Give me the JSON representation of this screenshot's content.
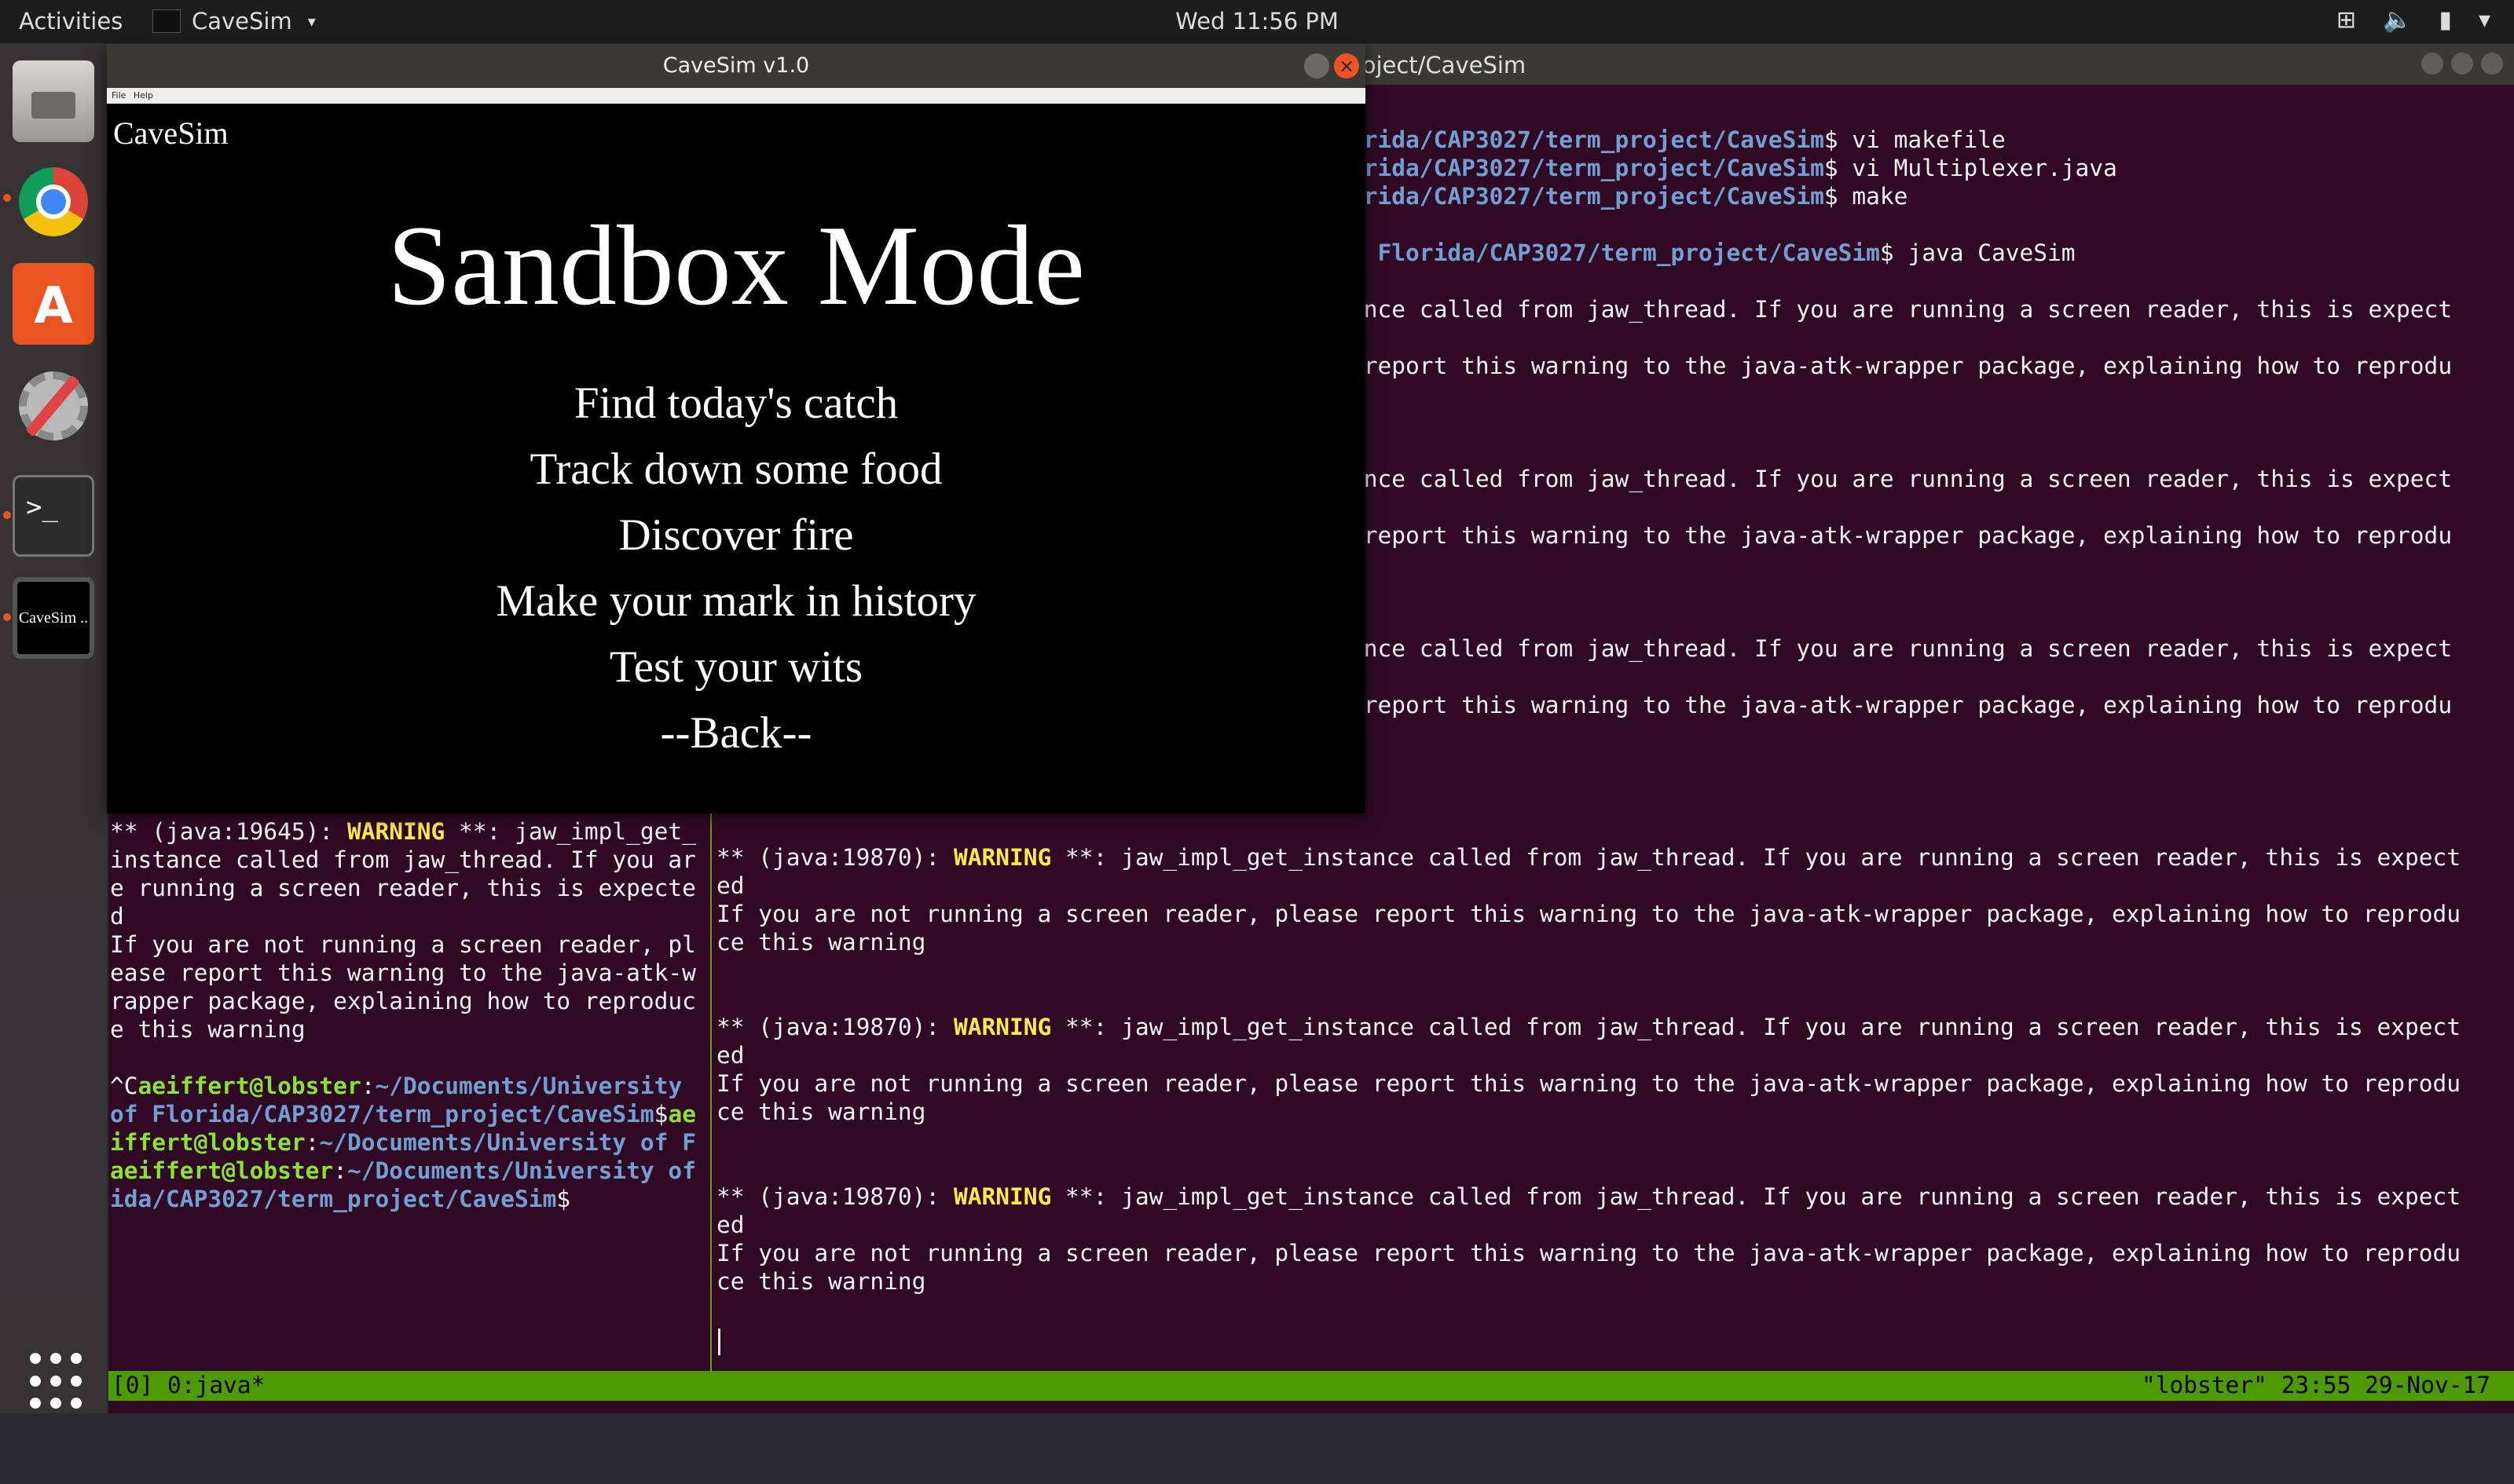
{
  "topbar": {
    "activities": "Activities",
    "app_name": "CaveSim",
    "clock": "Wed 11:56 PM",
    "tray_icons": [
      "network-icon",
      "volume-icon",
      "battery-icon",
      "menu-caret-icon"
    ]
  },
  "dock": {
    "items": [
      "Files",
      "Google Chrome",
      "Ubuntu Software",
      "System Settings",
      "Terminal",
      "CaveSim"
    ],
    "cavesim_label": "CaveSim ..",
    "terminal_glyph": ">_",
    "store_glyph": "A"
  },
  "terminal": {
    "title": "orida/CAP3027/term_project/CaveSim",
    "left_pane_lines": [
      [
        {
          "t": "** (java:19645): "
        },
        {
          "t": "WARNING",
          "c": "warn"
        },
        {
          "t": " **: jaw_impl_get_"
        }
      ],
      [
        {
          "t": "instance called from jaw_thread. If you ar"
        }
      ],
      [
        {
          "t": "e running a screen reader, this is expecte"
        }
      ],
      [
        {
          "t": "d"
        }
      ],
      [
        {
          "t": "If you are not running a screen reader, pl"
        }
      ],
      [
        {
          "t": "ease report this warning to the java-atk-w"
        }
      ],
      [
        {
          "t": "rapper package, explaining how to reproduc"
        }
      ],
      [
        {
          "t": "e this warning"
        }
      ],
      [
        {
          "t": ""
        }
      ],
      [
        {
          "t": "^C"
        },
        {
          "t": "aeiffert@lobster",
          "c": "user"
        },
        {
          "t": ":"
        },
        {
          "t": "~/Documents/University",
          "c": "path"
        }
      ],
      [
        {
          "t": "of Florida/CAP3027/term_project/CaveSim",
          "c": "path"
        },
        {
          "t": "$"
        },
        {
          "t": "ae",
          "c": "user"
        }
      ],
      [
        {
          "t": "iffert@lobster",
          "c": "user"
        },
        {
          "t": ":"
        },
        {
          "t": "~/Documents/University of F",
          "c": "path"
        }
      ],
      [
        {
          "t": "aeiffert@lobster",
          "c": "user"
        },
        {
          "t": ":"
        },
        {
          "t": "~/Documents/University of",
          "c": "path"
        }
      ],
      [
        {
          "t": "ida/CAP3027/term_project/CaveSim",
          "c": "path"
        },
        {
          "t": "$"
        }
      ]
    ],
    "right_top_lines": [
      [
        {
          "t": "orida/CAP3027/term_project/CaveSim",
          "c": "path"
        },
        {
          "t": "$ vi makefile"
        }
      ],
      [
        {
          "t": "orida/CAP3027/term_project/CaveSim",
          "c": "path"
        },
        {
          "t": "$ vi Multiplexer.java"
        }
      ],
      [
        {
          "t": "orida/CAP3027/term_project/CaveSim",
          "c": "path"
        },
        {
          "t": "$ make"
        }
      ],
      [
        {
          "t": ""
        }
      ],
      [
        {
          "t": "f Florida/CAP3027/term_project/CaveSim",
          "c": "path"
        },
        {
          "t": "$ java CaveSim"
        }
      ],
      [
        {
          "t": ""
        }
      ],
      [
        {
          "t": "ance called from jaw_thread. If you are running a screen reader, this is expect"
        }
      ],
      [
        {
          "t": ""
        }
      ],
      [
        {
          "t": " report this warning to the java-atk-wrapper package, explaining how to reprodu"
        }
      ],
      [
        {
          "t": ""
        }
      ],
      [
        {
          "t": ""
        }
      ],
      [
        {
          "t": ""
        }
      ],
      [
        {
          "t": "ance called from jaw_thread. If you are running a screen reader, this is expect"
        }
      ],
      [
        {
          "t": ""
        }
      ],
      [
        {
          "t": " report this warning to the java-atk-wrapper package, explaining how to reprodu"
        }
      ],
      [
        {
          "t": ""
        }
      ],
      [
        {
          "t": ""
        }
      ],
      [
        {
          "t": ""
        }
      ],
      [
        {
          "t": "ance called from jaw_thread. If you are running a screen reader, this is expect"
        }
      ],
      [
        {
          "t": ""
        }
      ],
      [
        {
          "t": " report this warning to the java-atk-wrapper package, explaining how to reprodu"
        }
      ],
      [
        {
          "t": ""
        }
      ],
      [
        {
          "t": ""
        }
      ],
      [
        {
          "t": ""
        }
      ]
    ],
    "right_pane_lines": [
      [
        {
          "t": "** (java:19870): "
        },
        {
          "t": "WARNING",
          "c": "warn"
        },
        {
          "t": " **: jaw_impl_get_instance called from jaw_thread. If you are running a screen reader, this is expect"
        }
      ],
      [
        {
          "t": "ed"
        }
      ],
      [
        {
          "t": "If you are not running a screen reader, please report this warning to the java-atk-wrapper package, explaining how to reprodu"
        }
      ],
      [
        {
          "t": "ce this warning"
        }
      ],
      [
        {
          "t": ""
        }
      ],
      [
        {
          "t": ""
        }
      ],
      [
        {
          "t": "** (java:19870): "
        },
        {
          "t": "WARNING",
          "c": "warn"
        },
        {
          "t": " **: jaw_impl_get_instance called from jaw_thread. If you are running a screen reader, this is expect"
        }
      ],
      [
        {
          "t": "ed"
        }
      ],
      [
        {
          "t": "If you are not running a screen reader, please report this warning to the java-atk-wrapper package, explaining how to reprodu"
        }
      ],
      [
        {
          "t": "ce this warning"
        }
      ],
      [
        {
          "t": ""
        }
      ],
      [
        {
          "t": ""
        }
      ],
      [
        {
          "t": "** (java:19870): "
        },
        {
          "t": "WARNING",
          "c": "warn"
        },
        {
          "t": " **: jaw_impl_get_instance called from jaw_thread. If you are running a screen reader, this is expect"
        }
      ],
      [
        {
          "t": "ed"
        }
      ],
      [
        {
          "t": "If you are not running a screen reader, please report this warning to the java-atk-wrapper package, explaining how to reprodu"
        }
      ],
      [
        {
          "t": "ce this warning"
        }
      ]
    ],
    "tmux_left": "[0] 0:java*",
    "tmux_right": "\"lobster\" 23:55 29-Nov-17"
  },
  "cavesim": {
    "window_title": "CaveSim v1.0",
    "menu": [
      "File",
      "Help"
    ],
    "brand": "CaveSim",
    "heading": "Sandbox Mode",
    "options": [
      "Find today's catch",
      "Track down some food",
      "Discover fire",
      "Make your mark in history",
      "Test your wits",
      "--Back--"
    ],
    "close_glyph": "×"
  },
  "colors": {
    "terminal_bg": "#300a24",
    "warning": "#fce94f",
    "prompt_user": "#8ae234",
    "prompt_path": "#729fcf",
    "tmux_bar": "#4e9a06",
    "ubuntu_orange": "#e95420"
  }
}
